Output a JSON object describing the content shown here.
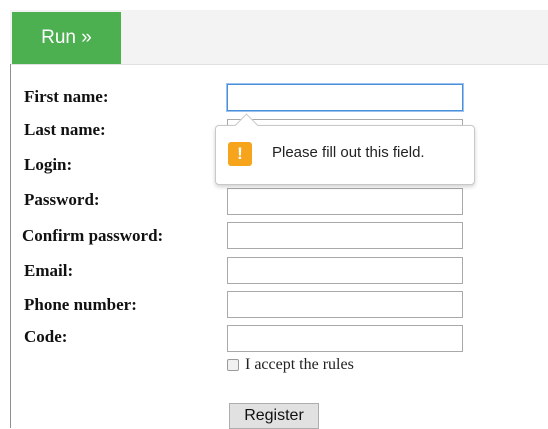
{
  "toolbar": {
    "run_label": "Run »"
  },
  "form": {
    "labels": {
      "first_name": "First name:",
      "last_name": "Last name:",
      "login": "Login:",
      "password": "Password:",
      "confirm_password": "Confirm password:",
      "email": "Email:",
      "phone": "Phone number:",
      "code": "Code:"
    },
    "values": {
      "first_name": "",
      "last_name": "",
      "login": "",
      "password": "",
      "confirm_password": "",
      "email": "",
      "phone": "",
      "code": ""
    },
    "accept_label": "I accept the rules",
    "accept_checked": false,
    "register_label": "Register"
  },
  "validation_tooltip": {
    "message": "Please fill out this field.",
    "icon": "warning-icon",
    "icon_glyph": "!",
    "icon_color": "#f7a41d"
  },
  "colors": {
    "run_button": "#4caf50",
    "focus_border": "#4a90d9"
  }
}
